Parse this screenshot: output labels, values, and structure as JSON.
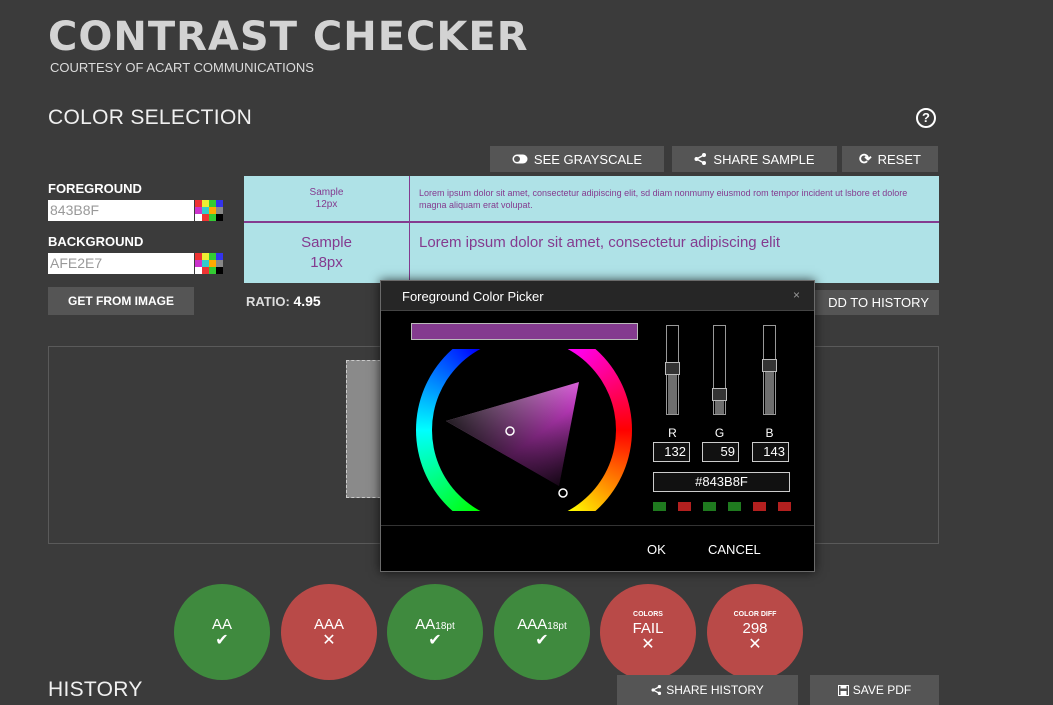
{
  "header": {
    "title": "CONTRAST CHECKER",
    "subtitle": "COURTESY OF ACART COMMUNICATIONS"
  },
  "color_selection": {
    "title": "COLOR SELECTION",
    "help_icon": "?",
    "buttons": {
      "grayscale": "SEE GRAYSCALE",
      "share_sample": "SHARE SAMPLE",
      "reset": "RESET"
    },
    "foreground": {
      "label": "FOREGROUND",
      "value": "843B8F"
    },
    "background": {
      "label": "BACKGROUND",
      "value": "AFE2E7"
    },
    "get_from_image": "GET FROM IMAGE",
    "ratio_label": "RATIO:",
    "ratio_value": "4.95",
    "add_to_history": "DD TO HISTORY"
  },
  "samples": [
    {
      "size_label": "Sample",
      "size_px": "12px",
      "text": "Lorem ipsum dolor sit amet, consectetur adipiscing elit, sd diam nonmumy eiusmod rom tempor incident ut lsbore et dolore magna aliquam erat volupat."
    },
    {
      "size_label": "Sample",
      "size_px": "18px",
      "text": "Lorem ipsum dolor sit amet, consectetur adipiscing elit"
    }
  ],
  "colors": {
    "foreground": "#843b8f",
    "background": "#afe2e7",
    "pass": "#3f8a3e",
    "fail": "#b94a48"
  },
  "results": [
    {
      "label": "AA",
      "suffix": "",
      "top": "",
      "mark": "✔",
      "status": "pass"
    },
    {
      "label": "AAA",
      "suffix": "",
      "top": "",
      "mark": "✕",
      "status": "fail"
    },
    {
      "label": "AA",
      "suffix": "18pt",
      "top": "",
      "mark": "✔",
      "status": "pass"
    },
    {
      "label": "AAA",
      "suffix": "18pt",
      "top": "",
      "mark": "✔",
      "status": "pass"
    },
    {
      "label": "FAIL",
      "suffix": "",
      "top": "COLORS",
      "mark": "✕",
      "status": "fail"
    },
    {
      "label": "298",
      "suffix": "",
      "top": "COLOR DIFF",
      "mark": "✕",
      "status": "fail"
    }
  ],
  "history": {
    "title": "HISTORY",
    "share": "SHARE HISTORY",
    "save_pdf": "SAVE PDF"
  },
  "picker": {
    "title": "Foreground Color Picker",
    "close": "×",
    "r": {
      "label": "R",
      "value": "132",
      "level": 0.52
    },
    "g": {
      "label": "G",
      "value": "59",
      "level": 0.23
    },
    "b": {
      "label": "B",
      "value": "143",
      "level": 0.56
    },
    "hex": "#843B8F",
    "indicators": [
      "pass",
      "fail",
      "pass",
      "pass",
      "fail",
      "fail"
    ],
    "ok": "OK",
    "cancel": "CANCEL"
  }
}
